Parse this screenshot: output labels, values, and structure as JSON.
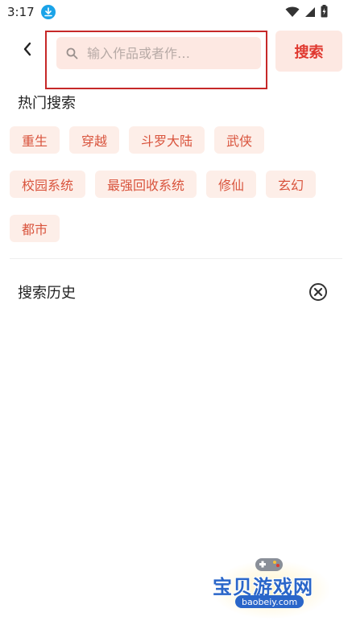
{
  "status_bar": {
    "time": "3:17"
  },
  "search": {
    "placeholder": "输入作品或者作…",
    "button_label": "搜索"
  },
  "hot": {
    "title": "热门搜索",
    "tags": [
      "重生",
      "穿越",
      "斗罗大陆",
      "武侠",
      "校园系统",
      "最强回收系统",
      "修仙",
      "玄幻",
      "都市"
    ]
  },
  "history": {
    "title": "搜索历史"
  },
  "watermark": {
    "title": "宝贝游戏网",
    "url": "baobeiy.com"
  },
  "colors": {
    "accent": "#e0382f",
    "tag_bg": "#fdeee8",
    "tag_text": "#d9543d",
    "highlight_border": "#c62828"
  }
}
